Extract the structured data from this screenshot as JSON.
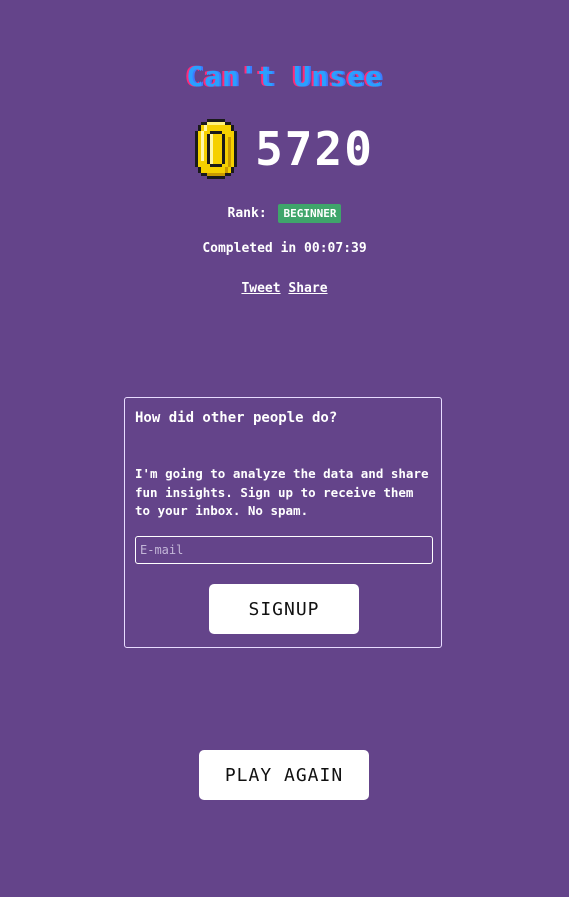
{
  "game": {
    "title": "Can't Unsee",
    "score": "5720",
    "coin_icon": "coin-icon"
  },
  "result": {
    "rank_label": "Rank:",
    "rank_value": "BEGINNER",
    "rank_color": "#3fa56b",
    "completed_text": "Completed in 00:07:39"
  },
  "share": {
    "tweet_label": "Tweet",
    "share_label": "Share"
  },
  "signup_card": {
    "heading": "How did other people do?",
    "body": "I'm going to analyze the data and share fun insights. Sign up to receive them to your inbox. No spam.",
    "email_placeholder": "E-mail",
    "email_value": "",
    "button_label": "SIGNUP"
  },
  "play_again_label": "PLAY AGAIN",
  "colors": {
    "background": "#64448a",
    "title_blue": "#2aa0ff",
    "title_pink": "#ff2a7a",
    "coin_gold": "#f5d000"
  }
}
